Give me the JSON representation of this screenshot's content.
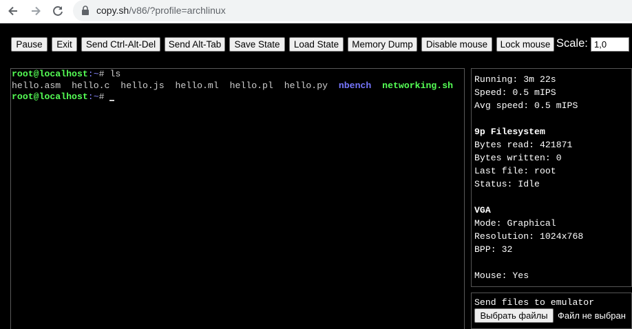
{
  "browser": {
    "url_host": "copy.sh",
    "url_path": "/v86/?profile=archlinux"
  },
  "toolbar": {
    "buttons": [
      "Pause",
      "Exit",
      "Send Ctrl-Alt-Del",
      "Send Alt-Tab",
      "Save State",
      "Load State",
      "Memory Dump",
      "Disable mouse",
      "Lock mouse"
    ],
    "scale_label": "Scale:",
    "scale_value": "1,0"
  },
  "terminal": {
    "prompt_user": "root@localhost",
    "prompt_path": ":~",
    "prompt_symbol": "# ",
    "command": "ls",
    "files_plain": [
      "hello.asm",
      "hello.c",
      "hello.js",
      "hello.ml",
      "hello.pl",
      "hello.py"
    ],
    "file_dir": "nbench",
    "file_exec": "networking.sh"
  },
  "info": {
    "running": "Running: 3m 22s",
    "speed": "Speed: 0.5 mIPS",
    "avg_speed": "Avg speed: 0.5 mIPS",
    "fs_title": "9p Filesystem",
    "bytes_read": "Bytes read: 421871",
    "bytes_written": "Bytes written: 0",
    "last_file": "Last file: root",
    "status": "Status: Idle",
    "vga_title": "VGA",
    "mode": "Mode: Graphical",
    "resolution": "Resolution: 1024x768",
    "bpp": "BPP: 32",
    "mouse": "Mouse: Yes"
  },
  "upload": {
    "title": "Send files to emulator",
    "button": "Выбрать файлы",
    "status": "Файл не выбран"
  },
  "colors": {
    "prompt_green": "#55ff55",
    "dir_blue": "#7777ff",
    "path_blue": "#8888ff"
  }
}
